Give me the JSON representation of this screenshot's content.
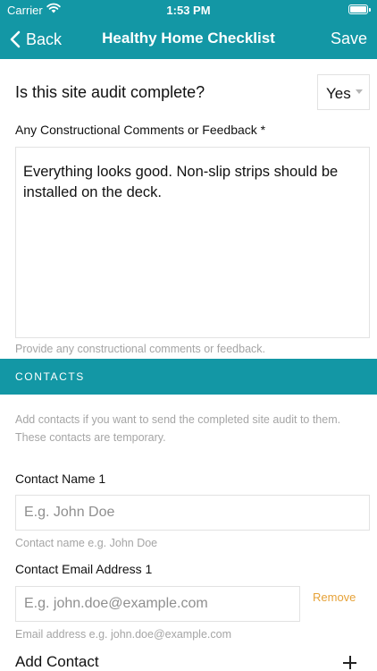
{
  "status_bar": {
    "carrier": "Carrier",
    "time": "1:53 PM"
  },
  "nav": {
    "back_label": "Back",
    "title": "Healthy Home Checklist",
    "save_label": "Save"
  },
  "audit_question": {
    "label": "Is this site audit complete?",
    "selected_value": "Yes"
  },
  "comments": {
    "label": "Any Constructional Comments or Feedback *",
    "value": "Everything looks good. Non-slip strips should be installed on the deck.",
    "hint": "Provide any constructional comments or feedback."
  },
  "contacts": {
    "header": "CONTACTS",
    "description": "Add contacts if you want to send the completed site audit to them. These contacts are temporary.",
    "name_field": {
      "label": "Contact Name 1",
      "placeholder": "E.g. John Doe",
      "hint": "Contact name e.g. John Doe"
    },
    "email_field": {
      "label": "Contact Email Address 1",
      "placeholder": "E.g. john.doe@example.com",
      "hint": "Email address e.g. john.doe@example.com"
    },
    "remove_label": "Remove",
    "add_label": "Add Contact"
  },
  "colors": {
    "accent": "#1397a5",
    "remove": "#e6a238"
  },
  "icons": {
    "back": "chevron-left-icon",
    "wifi": "wifi-icon",
    "battery": "battery-icon",
    "caret": "caret-down-icon",
    "add": "plus-icon"
  }
}
